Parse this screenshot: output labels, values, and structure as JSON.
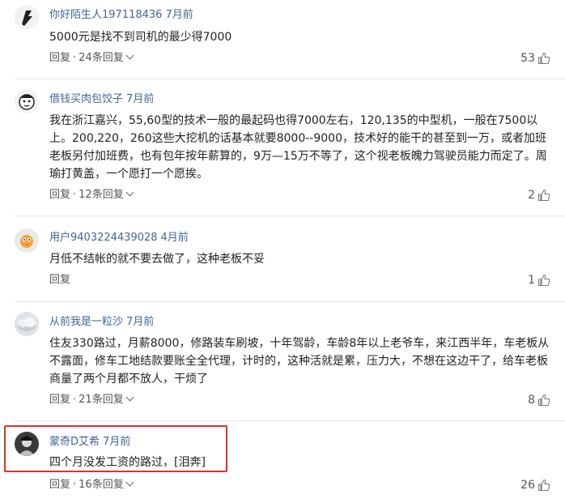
{
  "comments": [
    {
      "user": "你好陌生人197118436",
      "time": "7月前",
      "text": "5000元是找不到司机的最少得7000",
      "reply_label": "回复",
      "reply_count": "24条回复",
      "likes": "53"
    },
    {
      "user": "借钱买肉包饺子",
      "time": "7月前",
      "text": "我在浙江嘉兴，55,60型的技术一般的最起码也得7000左右，120,135的中型机，一般在7500以上。200,220，260这些大挖机的话基本就要8000--9000，技术好的能干的甚至到一万，或者加班老板另付加班费，也有包年按年薪算的，9万—15万不等了，这个视老板魄力驾驶员能力而定了。周瑜打黄盖，一个愿打一个愿挨。",
      "reply_label": "回复",
      "reply_count": "12条回复",
      "likes": "2"
    },
    {
      "user": "用户9403224439028",
      "time": "4月前",
      "text": "月低不结帐的就不要去做了，这种老板不妥",
      "reply_label": "回复",
      "reply_count": "",
      "likes": "1"
    },
    {
      "user": "从前我是一粒沙",
      "time": "7月前",
      "text": "住友330路过，月薪8000，修路装车刷坡，十年驾龄，车龄8年以上老爷车，来江西半年，车老板从不露面，修车工地结款要账全全代理，计时的，这种活就是累，压力大，不想在这边干了，给车老板商量了两个月都不放人，干烦了",
      "reply_label": "回复",
      "reply_count": "21条回复",
      "likes": "8"
    },
    {
      "user": "蒙奇D艾希",
      "time": "7月前",
      "text": "四个月没发工资的路过，[泪奔]",
      "reply_label": "回复",
      "reply_count": "16条回复",
      "likes": "26"
    }
  ],
  "colors": {
    "username": "#406599",
    "highlight": "#e0302c",
    "divider": "#e8e8e8"
  },
  "icons": {
    "like": "thumbs-up-icon",
    "expand": "chevron-down-icon"
  }
}
